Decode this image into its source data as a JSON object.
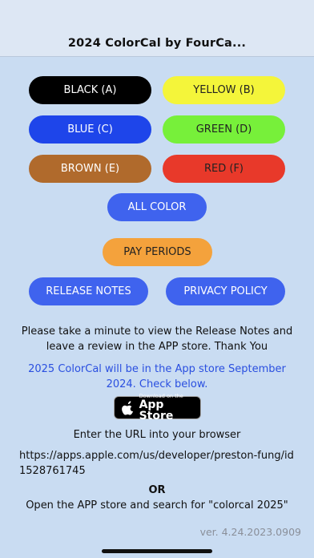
{
  "header": {
    "title": "2024 ColorCal by FourCa..."
  },
  "buttons": {
    "black": {
      "label": "BLACK (A)",
      "bg": "#000000",
      "fg": "#ffffff"
    },
    "yellow": {
      "label": "YELLOW (B)",
      "bg": "#f4f53a",
      "fg": "#222222"
    },
    "blue": {
      "label": "BLUE (C)",
      "bg": "#1e45ea",
      "fg": "#ffffff"
    },
    "green": {
      "label": "GREEN (D)",
      "bg": "#77f03a",
      "fg": "#222222"
    },
    "brown": {
      "label": "BROWN (E)",
      "bg": "#b06a2c",
      "fg": "#ffffff"
    },
    "red": {
      "label": "RED (F)",
      "bg": "#e8392a",
      "fg": "#222222"
    },
    "all_color": {
      "label": "ALL COLOR",
      "bg": "#3f63ee",
      "fg": "#ffffff"
    },
    "pay_periods": {
      "label": "PAY PERIODS",
      "bg": "#f4a23c",
      "fg": "#222222"
    },
    "release_notes": {
      "label": "RELEASE NOTES",
      "bg": "#3f63ee",
      "fg": "#ffffff"
    },
    "privacy_policy": {
      "label": "PRIVACY POLICY",
      "bg": "#3f63ee",
      "fg": "#ffffff"
    }
  },
  "messages": {
    "review": "Please take a minute to view the Release Notes and leave a review in the APP store. Thank You",
    "announcement": "2025 ColorCal will be in the App store September 2024. Check below.",
    "enter_url": "Enter the URL into your browser",
    "url": "https://apps.apple.com/us/developer/preston-fung/id1528761745",
    "or": "OR",
    "search": "Open the APP store and search for \"colorcal 2025\""
  },
  "store_badge": {
    "small_text": "Download on the",
    "big_text": "App Store",
    "icon": "apple-logo-icon"
  },
  "version": "ver. 4.24.2023.0909",
  "colors": {
    "announcement": "#2a4fe0",
    "background": "#c9dcf2"
  }
}
